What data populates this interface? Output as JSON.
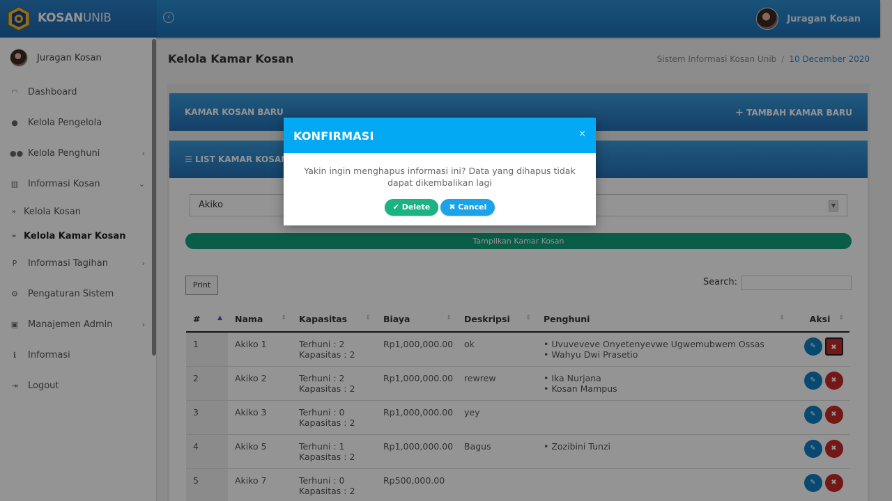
{
  "brand": {
    "bold": "KOSAN",
    "light": "UNIB"
  },
  "topbar": {
    "user_name": "Juragan Kosan",
    "collapse_icon": "circle-arrow-left-icon"
  },
  "sidebar": {
    "user_name": "Juragan Kosan",
    "items": [
      {
        "label": "Dashboard",
        "icon": "dashboard-icon"
      },
      {
        "label": "Kelola Pengelola",
        "icon": "user-icon"
      },
      {
        "label": "Kelola Penghuni",
        "icon": "users-icon"
      },
      {
        "label": "Informasi Kosan",
        "icon": "bank-icon"
      },
      {
        "label": "Kelola Kosan",
        "icon": "double-chevron-icon"
      },
      {
        "label": "Kelola Kamar Kosan",
        "icon": "double-chevron-icon"
      },
      {
        "label": "Informasi Tagihan",
        "icon": "paypal-icon"
      },
      {
        "label": "Pengaturan Sistem",
        "icon": "gears-icon"
      },
      {
        "label": "Manajemen Admin",
        "icon": "cubes-icon"
      },
      {
        "label": "Informasi",
        "icon": "info-icon"
      },
      {
        "label": "Logout",
        "icon": "sign-out-icon"
      }
    ]
  },
  "header": {
    "title": "Kelola Kamar Kosan",
    "breadcrumb_root": "Sistem Informasi Kosan Unib",
    "breadcrumb_sep": "/",
    "breadcrumb_date": "10 December 2020"
  },
  "panel_new": {
    "title": "KAMAR KOSAN BARU",
    "add_label": "TAMBAH KAMAR BARU"
  },
  "panel_list": {
    "title": "LIST KAMAR KOSAN"
  },
  "filter": {
    "selected_kosan": "Akiko",
    "show_button": "Tampilkan Kamar Kosan"
  },
  "toolbar": {
    "print_label": "Print",
    "search_label": "Search:",
    "search_value": ""
  },
  "table": {
    "headers": [
      "#",
      "Nama",
      "Kapasitas",
      "Biaya",
      "Deskripsi",
      "Penghuni",
      "Aksi"
    ],
    "rows": [
      {
        "no": "1",
        "nama": "Akiko 1",
        "terhuni": "Terhuni : 2",
        "kapasitas": "Kapasitas : 2",
        "biaya": "Rp1,000,000.00",
        "deskripsi": "ok",
        "penghuni1": "• Uvuveveve Onyetenyevwe Ugwemubwem Ossas",
        "penghuni2": "• Wahyu Dwi Prasetio"
      },
      {
        "no": "2",
        "nama": "Akiko 2",
        "terhuni": "Terhuni : 2",
        "kapasitas": "Kapasitas : 2",
        "biaya": "Rp1,000,000.00",
        "deskripsi": "rewrew",
        "penghuni1": "• Ika Nurjana",
        "penghuni2": "• Kosan Mampus"
      },
      {
        "no": "3",
        "nama": "Akiko 3",
        "terhuni": "Terhuni : 0",
        "kapasitas": "Kapasitas : 2",
        "biaya": "Rp1,000,000.00",
        "deskripsi": "yey",
        "penghuni1": "",
        "penghuni2": ""
      },
      {
        "no": "4",
        "nama": "Akiko 5",
        "terhuni": "Terhuni : 1",
        "kapasitas": "Kapasitas : 2",
        "biaya": "Rp1,000,000.00",
        "deskripsi": "Bagus",
        "penghuni1": "• Zozibini Tunzi",
        "penghuni2": ""
      },
      {
        "no": "5",
        "nama": "Akiko 7",
        "terhuni": "Terhuni : 0",
        "kapasitas": "Kapasitas : 2",
        "biaya": "Rp500,000.00",
        "deskripsi": "",
        "penghuni1": "",
        "penghuni2": ""
      }
    ]
  },
  "modal": {
    "title": "KONFIRMASI",
    "close": "×",
    "message": "Yakin ingin menghapus informasi ini? Data yang dihapus tidak dapat dikembalikan lagi",
    "delete_label": "Delete",
    "cancel_label": "Cancel"
  }
}
